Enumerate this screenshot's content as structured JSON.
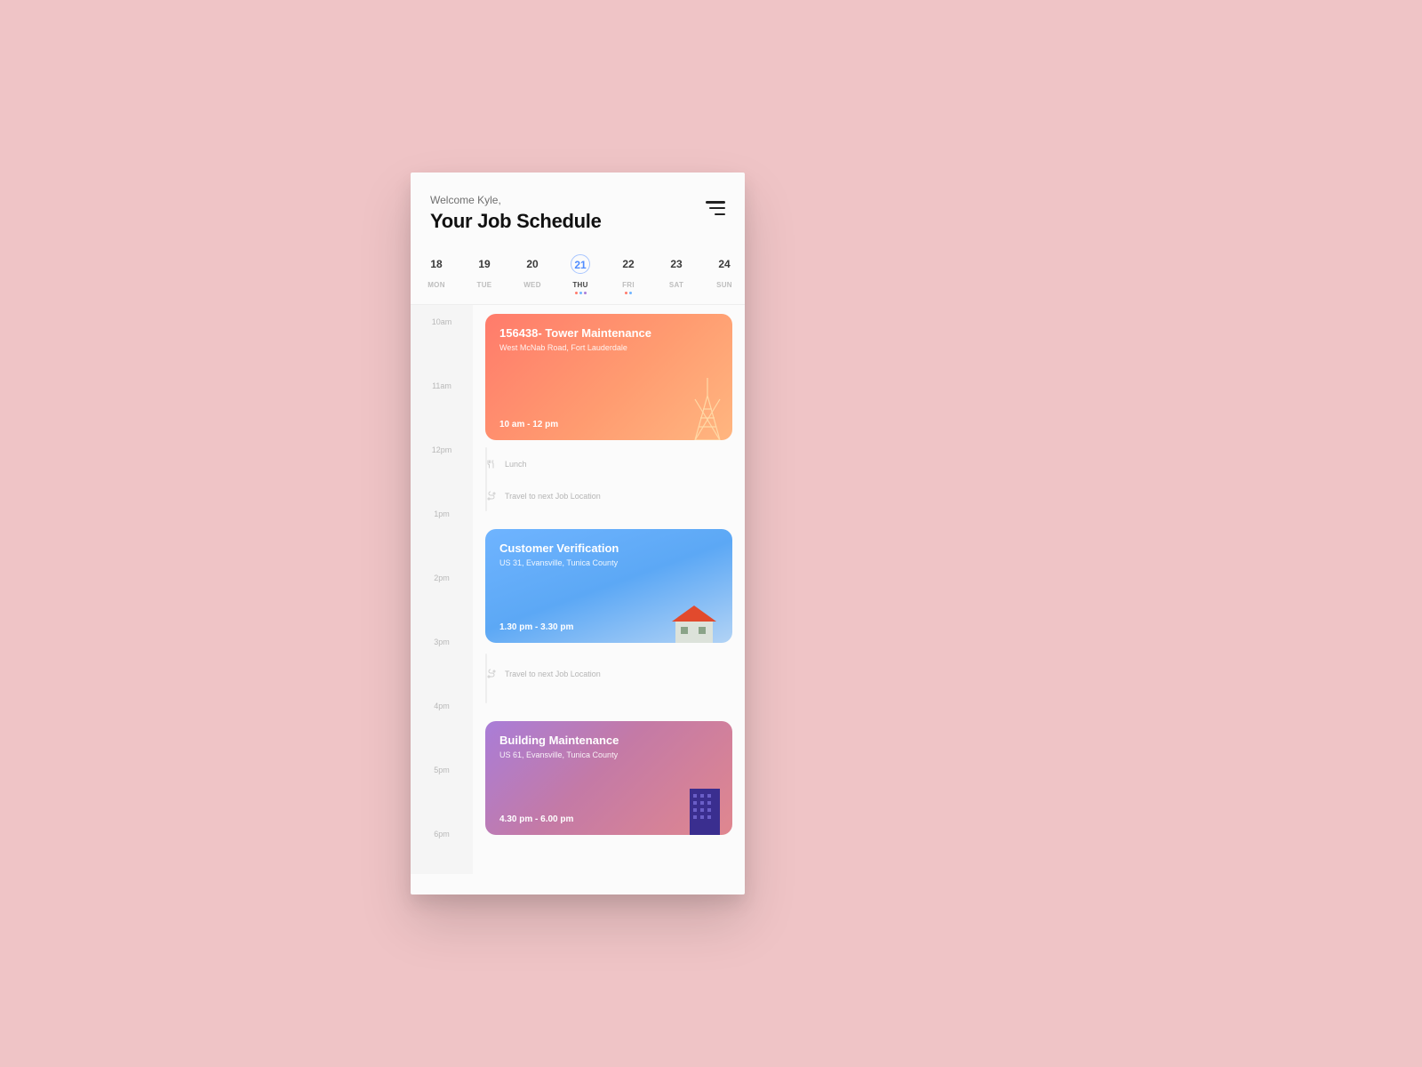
{
  "header": {
    "welcome": "Welcome Kyle,",
    "title": "Your Job Schedule"
  },
  "days": [
    {
      "num": "18",
      "dow": "MON",
      "selected": false,
      "dots": []
    },
    {
      "num": "19",
      "dow": "TUE",
      "selected": false,
      "dots": []
    },
    {
      "num": "20",
      "dow": "WED",
      "selected": false,
      "dots": []
    },
    {
      "num": "21",
      "dow": "THU",
      "selected": true,
      "dots": [
        "#ff7b6b",
        "#6fb4ff",
        "#a97dd8"
      ]
    },
    {
      "num": "22",
      "dow": "FRI",
      "selected": false,
      "dots": [
        "#ff7b6b",
        "#6fb4ff"
      ]
    },
    {
      "num": "23",
      "dow": "SAT",
      "selected": false,
      "dots": []
    },
    {
      "num": "24",
      "dow": "SUN",
      "selected": false,
      "dots": []
    }
  ],
  "times": [
    "10am",
    "11am",
    "12pm",
    "1pm",
    "2pm",
    "3pm",
    "4pm",
    "5pm",
    "6pm"
  ],
  "jobs": [
    {
      "title": "156438- Tower Maintenance",
      "location": "West McNab Road, Fort Lauderdale",
      "time": "10 am - 12 pm"
    },
    {
      "title": "Customer Verification",
      "location": "US 31, Evansville, Tunica County",
      "time": "1.30 pm - 3.30 pm"
    },
    {
      "title": "Building Maintenance",
      "location": "US 61, Evansville, Tunica County",
      "time": "4.30 pm - 6.00 pm"
    }
  ],
  "mini": [
    {
      "icon": "utensils-icon",
      "label": "Lunch"
    },
    {
      "icon": "route-icon",
      "label": "Travel to next Job Location"
    },
    {
      "icon": "route-icon",
      "label": "Travel to next Job Location"
    }
  ]
}
